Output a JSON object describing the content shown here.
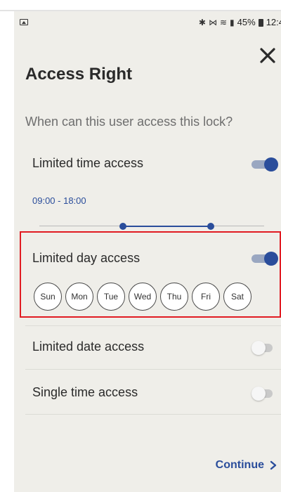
{
  "status_bar": {
    "right_text": "45%",
    "time": "12:4",
    "icons": [
      "gallery-icon",
      "bluetooth-icon",
      "vibrate-icon",
      "wifi-icon",
      "signal-icon",
      "battery-icon"
    ]
  },
  "header": {
    "title": "Access Right",
    "close_icon": "close-icon"
  },
  "question": "When can this user access this lock?",
  "options": {
    "limited_time": {
      "label": "Limited time access",
      "enabled": true,
      "range_text": "09:00 - 18:00",
      "range_start_fraction": 0.37,
      "range_end_fraction": 0.76
    },
    "limited_day": {
      "label": "Limited day access",
      "enabled": true,
      "days": [
        "Sun",
        "Mon",
        "Tue",
        "Wed",
        "Thu",
        "Fri",
        "Sat"
      ]
    },
    "limited_date": {
      "label": "Limited date access",
      "enabled": false
    },
    "single_time": {
      "label": "Single time access",
      "enabled": false
    }
  },
  "footer": {
    "continue_label": "Continue"
  },
  "colors": {
    "accent": "#2a4d9b",
    "background": "#efeee9",
    "highlight": "#e11b22"
  }
}
